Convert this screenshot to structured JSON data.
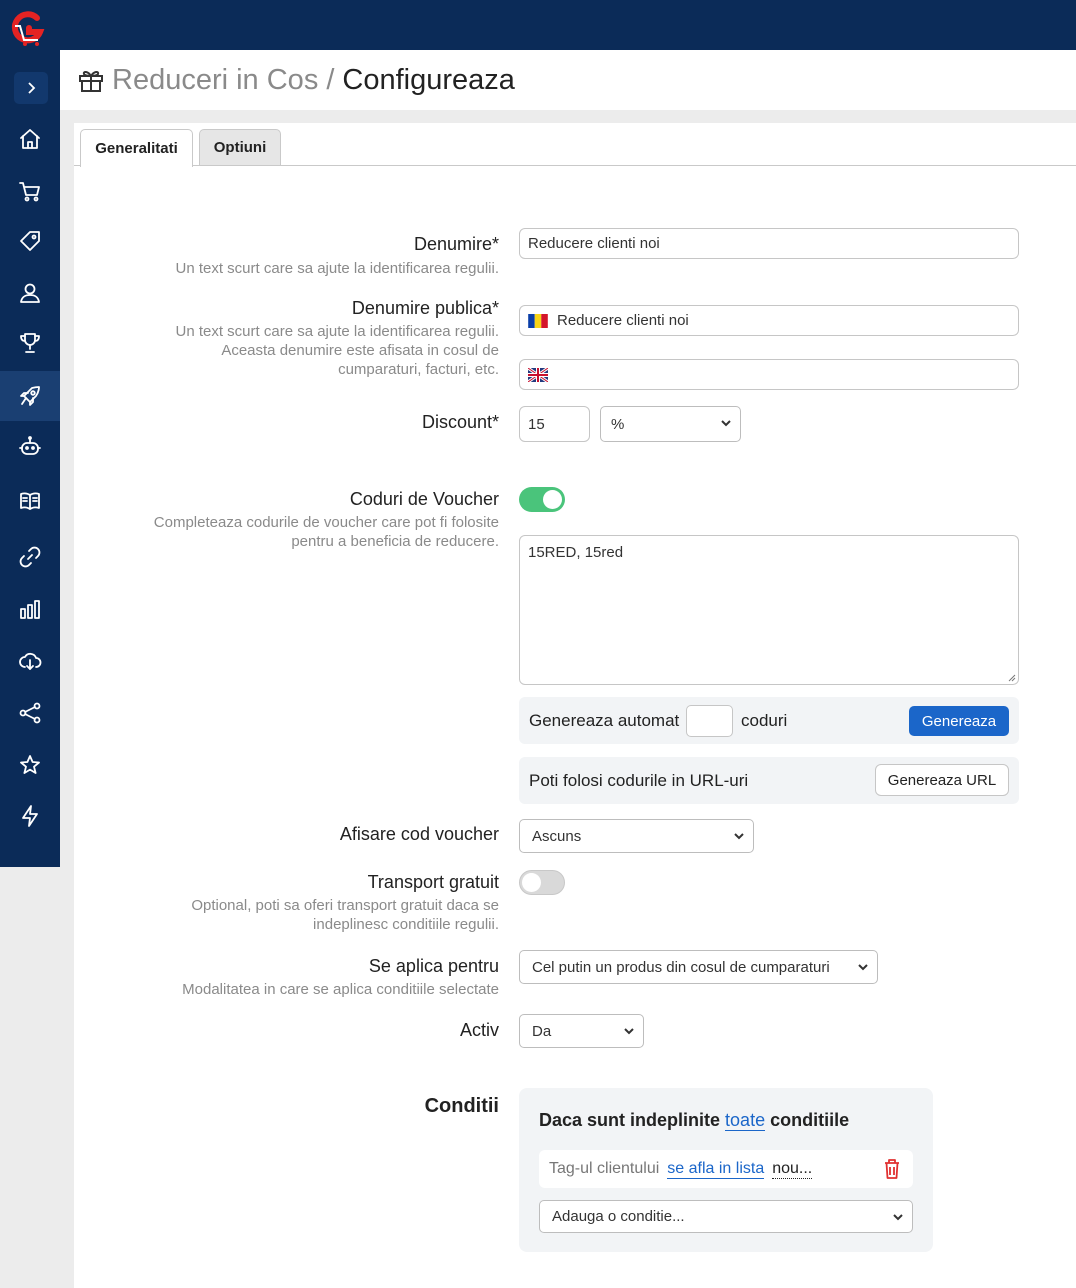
{
  "header": {
    "parent": "Reduceri in Cos",
    "separator": "/",
    "current": "Configureaza"
  },
  "sidebar": {
    "items": [
      {
        "icon": "home-icon"
      },
      {
        "icon": "cart-icon"
      },
      {
        "icon": "tag-icon"
      },
      {
        "icon": "customers-icon"
      },
      {
        "icon": "trophy-icon"
      },
      {
        "icon": "rocket-icon",
        "active": true
      },
      {
        "icon": "robot-icon"
      },
      {
        "icon": "book-icon"
      },
      {
        "icon": "link-icon"
      },
      {
        "icon": "chart-icon"
      },
      {
        "icon": "cloud-download-icon"
      },
      {
        "icon": "share-icon"
      },
      {
        "icon": "star-icon"
      },
      {
        "icon": "bolt-icon"
      }
    ]
  },
  "tabs": [
    "Generalitati",
    "Optiuni"
  ],
  "form": {
    "name": {
      "label": "Denumire*",
      "help": "Un text scurt care sa ajute la identificarea regulii.",
      "value": "Reducere clienti noi"
    },
    "public_name": {
      "label": "Denumire publica*",
      "help_line1": "Un text scurt care sa ajute la identificarea regulii.",
      "help_line2": "Aceasta denumire este afisata in cosul de",
      "help_line3": "cumparaturi, facturi, etc.",
      "value_ro": "Reducere clienti noi",
      "value_en": ""
    },
    "discount": {
      "label": "Discount*",
      "value": "15",
      "unit": "%"
    },
    "vouchers": {
      "label": "Coduri de Voucher",
      "help_line1": "Completeaza codurile de voucher care pot fi folosite",
      "help_line2": "pentru a beneficia de reducere.",
      "enabled": true,
      "codes": "15RED, 15red",
      "auto_generate_label": "Genereaza automat",
      "auto_generate_count": "",
      "auto_generate_suffix": "coduri",
      "generate_button": "Genereaza",
      "url_text": "Poti folosi codurile in URL-uri",
      "url_button": "Genereaza URL"
    },
    "voucher_display": {
      "label": "Afisare cod voucher",
      "value": "Ascuns"
    },
    "free_shipping": {
      "label": "Transport gratuit",
      "help_line1": "Optional, poti sa oferi transport gratuit daca se",
      "help_line2": "indeplinesc conditiile regulii.",
      "enabled": false
    },
    "applies_to": {
      "label": "Se aplica pentru",
      "help": "Modalitatea in care se aplica conditiile selectate",
      "value": "Cel putin un produs din cosul de cumparaturi"
    },
    "active": {
      "label": "Activ",
      "value": "Da"
    }
  },
  "conditions": {
    "label": "Conditii",
    "heading_prefix": "Daca sunt indeplinite",
    "heading_link": "toate",
    "heading_suffix": "conditiile",
    "rule_subject": "Tag-ul clientului",
    "rule_operator": "se afla in lista",
    "rule_value": "nou...",
    "add_placeholder": "Adauga o conditie..."
  },
  "colors": {
    "sidebar": "#0b2b58",
    "primary": "#1b66c9",
    "toggle_on": "#4ac47b",
    "delete": "#e03030"
  }
}
